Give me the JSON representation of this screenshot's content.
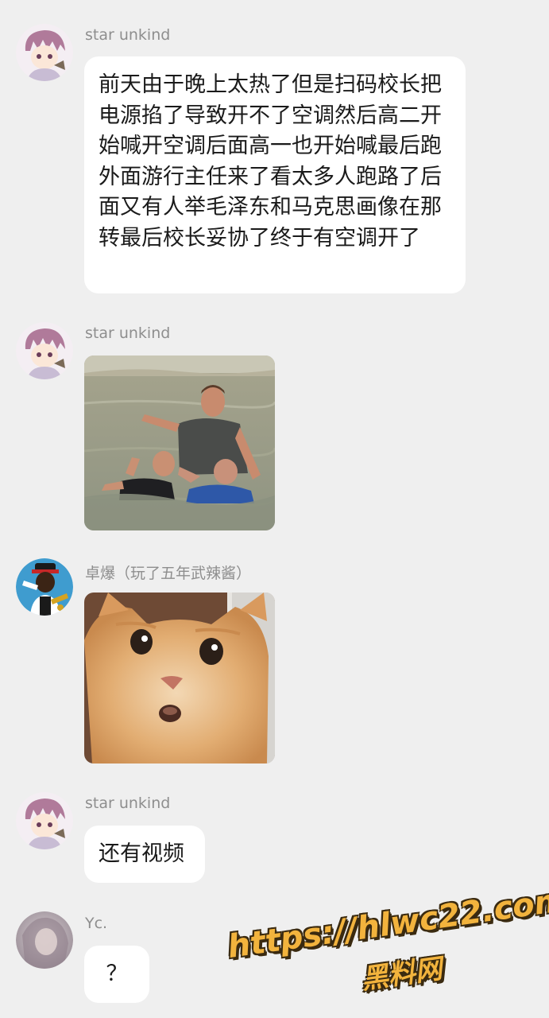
{
  "messages": [
    {
      "sender": "star unkind",
      "avatar_icon": "anime-character-avatar-icon",
      "text": "前天由于晚上太热了但是扫码校长把电源掐了导致开不了空调然后高二开始喊开空调后面高一也开始喊最后跑外面游行主任来了看太多人跑路了后面又有人举毛泽东和马克思画像在那转最后校长妥协了终于有空调开了"
    },
    {
      "sender": "star unkind",
      "avatar_icon": "anime-character-avatar-icon",
      "image": "men-saluting-in-water-photo"
    },
    {
      "sender": "卓爆（玩了五年武辣酱）",
      "avatar_icon": "saluting-soldier-avatar-icon",
      "image": "surprised-orange-cat-photo"
    },
    {
      "sender": "star unkind",
      "avatar_icon": "anime-character-avatar-icon",
      "text": "还有视频"
    },
    {
      "sender": "Yc.",
      "avatar_icon": "blurred-portrait-avatar-icon",
      "text": "？"
    }
  ],
  "watermark": {
    "url": "https://hlwc22.com",
    "name": "黑料网"
  },
  "colors": {
    "background": "#efefef",
    "bubble": "#ffffff",
    "sender": "#8e8e8e",
    "watermark": "#f2b33d"
  }
}
